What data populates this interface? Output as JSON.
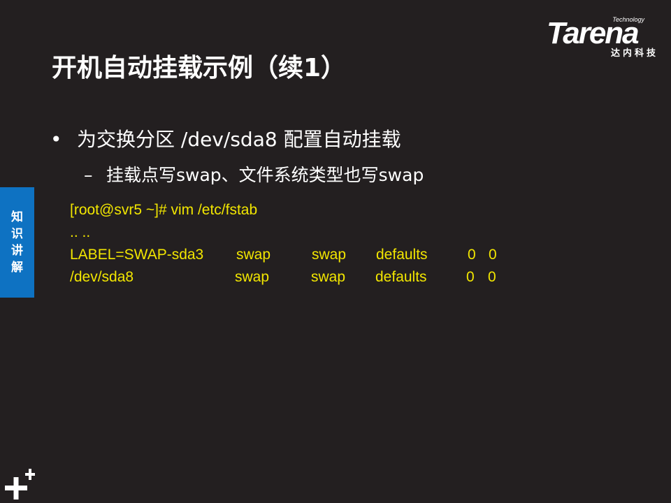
{
  "logo": {
    "word": "Tarena",
    "tagline": "Technology",
    "chinese": "达内科技"
  },
  "title": "开机自动挂载示例（续1）",
  "bullet": {
    "symbol": "•",
    "text": "为交换分区 /dev/sda8 配置自动挂载"
  },
  "sub_bullet": {
    "symbol": "–",
    "text": "挂载点写swap、文件系统类型也写swap"
  },
  "code": {
    "prompt_line": "[root@svr5 ~]# vim  /etc/fstab",
    "ellipsis_line": ".. ..",
    "rows": [
      {
        "device": "LABEL=SWAP-sda3",
        "mount": "swap",
        "fstype": "swap",
        "options": "defaults",
        "dump": "0",
        "pass": "0"
      },
      {
        "device": "/dev/sda8",
        "mount": "swap",
        "fstype": "swap",
        "options": "defaults",
        "dump": "0",
        "pass": "0"
      }
    ]
  },
  "side_tab": {
    "chars": [
      "知",
      "识",
      "讲",
      "解"
    ]
  },
  "colors": {
    "background": "#231f20",
    "code_text": "#f2e600",
    "side_tab": "#0e72c2",
    "text": "#ffffff"
  },
  "icons": {
    "corner": "plus-plus-icon"
  }
}
